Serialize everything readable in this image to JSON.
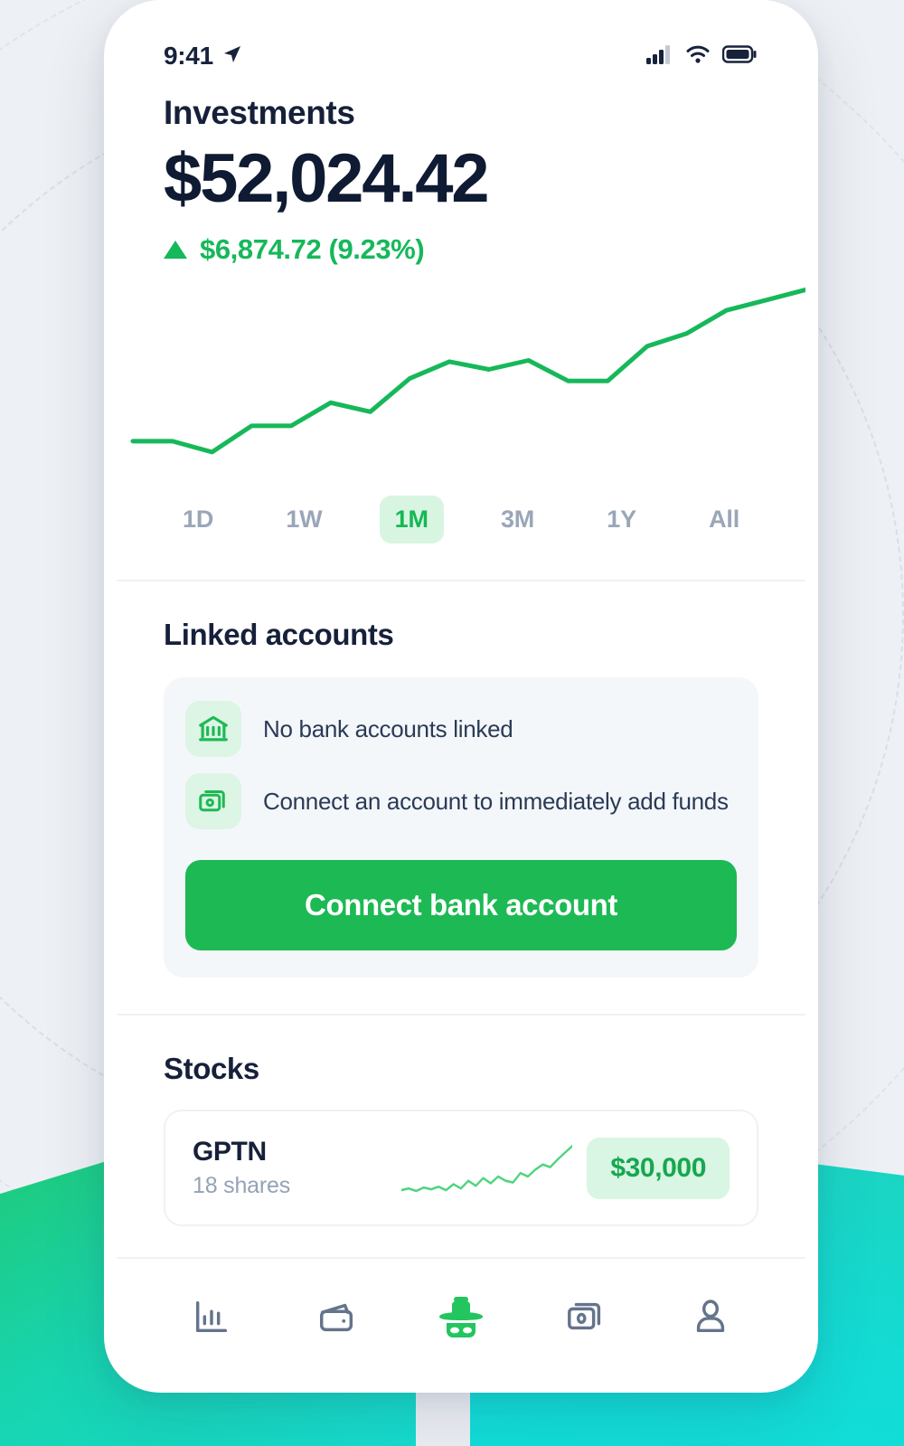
{
  "status_bar": {
    "time": "9:41",
    "location_icon": "location-arrow-icon",
    "signal_icon": "cellular-signal-icon",
    "wifi_icon": "wifi-icon",
    "battery_icon": "battery-full-icon"
  },
  "header": {
    "title": "Investments",
    "value": "$52,024.42",
    "change": "$6,874.72 (9.23%)",
    "change_direction": "up",
    "change_color": "#16b85a"
  },
  "chart_data": {
    "type": "line",
    "title": "",
    "xlabel": "",
    "ylabel": "",
    "line_color": "#16b85a",
    "grid": false,
    "legend": "none",
    "x": [
      0,
      1,
      2,
      3,
      4,
      5,
      6,
      7,
      8,
      9,
      10,
      11,
      12,
      13,
      14,
      15,
      16,
      17
    ],
    "values": [
      45200,
      45200,
      44350,
      46400,
      46400,
      48200,
      47500,
      50100,
      51400,
      50800,
      51500,
      49900,
      49900,
      52600,
      53600,
      55400,
      56200,
      57000
    ],
    "ylim": [
      43500,
      57600
    ]
  },
  "range_selector": {
    "selected": "1M",
    "options": [
      "1D",
      "1W",
      "1M",
      "3M",
      "1Y",
      "All"
    ],
    "active_color": "#15b854",
    "active_bg": "#d8f5e2"
  },
  "linked_accounts": {
    "title": "Linked accounts",
    "rows": [
      {
        "icon": "bank-icon",
        "text": "No bank accounts linked"
      },
      {
        "icon": "cash-stack-icon",
        "text": "Connect an account to immediately add funds"
      }
    ],
    "button_label": "Connect bank account",
    "button_color": "#1db954"
  },
  "stocks": {
    "title": "Stocks",
    "rows": [
      {
        "ticker": "GPTN",
        "shares": "18 shares",
        "amount": "$30,000",
        "sparkline": [
          22,
          24,
          21,
          25,
          23,
          26,
          22,
          29,
          24,
          33,
          27,
          36,
          30,
          38,
          33,
          31,
          42,
          38,
          46,
          52,
          49,
          58,
          66,
          74
        ]
      }
    ]
  },
  "bottom_nav": {
    "active": "incognito",
    "items": [
      {
        "icon": "bar-chart-icon",
        "active": false
      },
      {
        "icon": "wallet-icon",
        "active": false
      },
      {
        "icon": "incognito-icon",
        "active": true
      },
      {
        "icon": "cash-stack-icon",
        "active": false
      },
      {
        "icon": "person-icon",
        "active": false
      }
    ],
    "inactive_color": "#64748b",
    "active_color": "#22c55e"
  }
}
